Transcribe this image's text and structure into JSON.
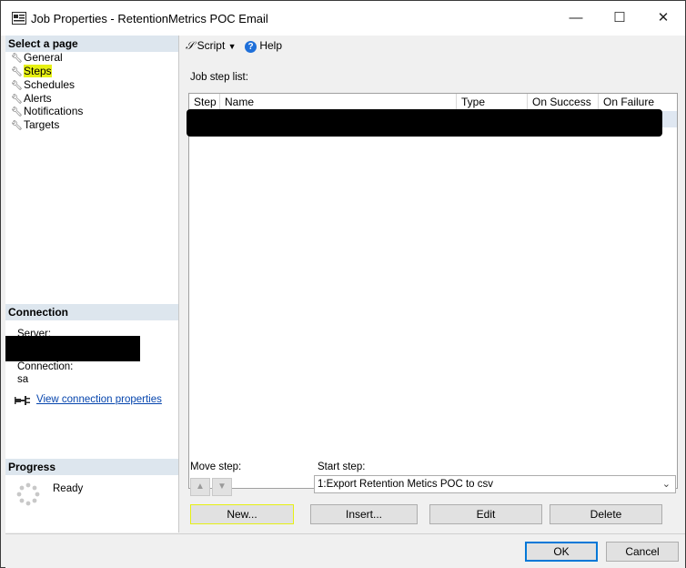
{
  "window": {
    "title": "Job Properties - RetentionMetrics POC Email",
    "minimize": "—",
    "maximize": "☐",
    "close": "✕"
  },
  "left": {
    "select_page_header": "Select a page",
    "pages": [
      {
        "label": "General"
      },
      {
        "label": "Steps"
      },
      {
        "label": "Schedules"
      },
      {
        "label": "Alerts"
      },
      {
        "label": "Notifications"
      },
      {
        "label": "Targets"
      }
    ],
    "connection_header": "Connection",
    "server_label": "Server:",
    "connection_label": "Connection:",
    "connection_value": "sa",
    "view_connection_link": "View connection properties",
    "progress_header": "Progress",
    "progress_status": "Ready"
  },
  "toolbar": {
    "script_label": "Script",
    "help_label": "Help"
  },
  "main": {
    "job_step_list_label": "Job step list:",
    "columns": [
      "Step",
      "Name",
      "Type",
      "On Success",
      "On Failure"
    ],
    "move_step_label": "Move step:",
    "start_step_label": "Start step:",
    "start_step_value": "1:Export Retention Metics POC to csv",
    "buttons": {
      "new": "New...",
      "insert": "Insert...",
      "edit": "Edit",
      "delete": "Delete"
    }
  },
  "footer": {
    "ok": "OK",
    "cancel": "Cancel"
  },
  "colors": {
    "highlight": "#e6f013",
    "section_header": "#dde6ee",
    "link": "#0645ad",
    "help_icon": "#1e6fd9"
  },
  "icons": [
    "window-icon",
    "wrench-icon",
    "script-icon",
    "dropdown-arrow-icon",
    "help-icon",
    "connection-plug-icon",
    "spinner-icon",
    "arrow-up-icon",
    "arrow-down-icon",
    "chevron-down-icon"
  ]
}
